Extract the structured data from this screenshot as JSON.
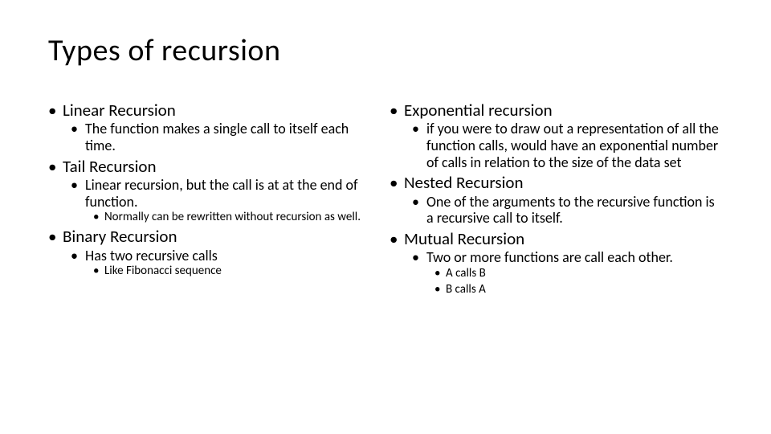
{
  "title": "Types of recursion",
  "left": {
    "items": [
      {
        "label": "Linear Recursion",
        "sub": [
          {
            "label": "The function makes a single call to itself each time."
          }
        ]
      },
      {
        "label": "Tail Recursion",
        "sub": [
          {
            "label": "Linear recursion, but the call is at at the end of function.",
            "sub": [
              {
                "label": "Normally can be rewritten without recursion as well."
              }
            ]
          }
        ]
      },
      {
        "label": "Binary Recursion",
        "sub": [
          {
            "label": "Has two recursive calls",
            "sub": [
              {
                "label": "Like Fibonacci sequence"
              }
            ]
          }
        ]
      }
    ]
  },
  "right": {
    "items": [
      {
        "label": "Exponential recursion",
        "sub": [
          {
            "label": "if you were to draw out a representation of all the function calls, would have an exponential number of calls in relation to the size of the data set"
          }
        ]
      },
      {
        "label": "Nested Recursion",
        "sub": [
          {
            "label": "One of the arguments to the recursive function is a recursive call to itself."
          }
        ]
      },
      {
        "label": "Mutual Recursion",
        "sub": [
          {
            "label": "Two or more functions are call each other.",
            "sub": [
              {
                "label": "A calls B"
              },
              {
                "label": "B calls A"
              }
            ]
          }
        ]
      }
    ]
  }
}
